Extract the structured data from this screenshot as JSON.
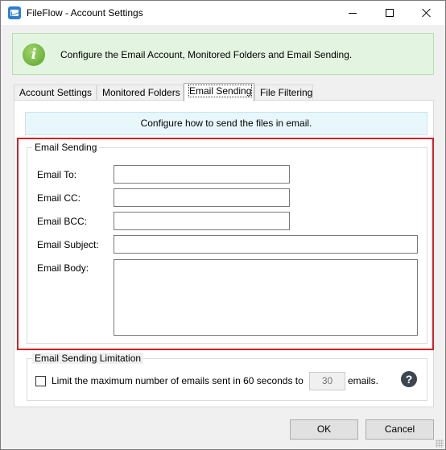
{
  "window": {
    "title": "FileFlow - Account Settings"
  },
  "banner": {
    "text": "Configure the Email Account, Monitored Folders and Email Sending.",
    "icon": "info-icon",
    "icon_glyph": "i"
  },
  "tabs": [
    {
      "label": "Account Settings",
      "active": false
    },
    {
      "label": "Monitored Folders",
      "active": false
    },
    {
      "label": "Email Sending",
      "active": true
    },
    {
      "label": "File Filtering",
      "active": false
    }
  ],
  "panel": {
    "config_text": "Configure how to send the files in email.",
    "email_group": {
      "legend": "Email Sending",
      "fields": {
        "to_label": "Email To:",
        "to_value": "",
        "cc_label": "Email CC:",
        "cc_value": "",
        "bcc_label": "Email BCC:",
        "bcc_value": "",
        "subject_label": "Email Subject:",
        "subject_value": "",
        "body_label": "Email Body:",
        "body_value": ""
      }
    },
    "limit_group": {
      "legend": "Email Sending Limitation",
      "checkbox_checked": false,
      "limit_label": "Limit the maximum number of emails sent in 60 seconds to",
      "limit_value": "30",
      "emails_label": "emails.",
      "help_glyph": "?"
    }
  },
  "buttons": {
    "ok": "OK",
    "cancel": "Cancel"
  },
  "colors": {
    "highlight": "#d61f2a",
    "banner_bg": "#e3f5e1",
    "config_bg": "#e8f7fc"
  }
}
